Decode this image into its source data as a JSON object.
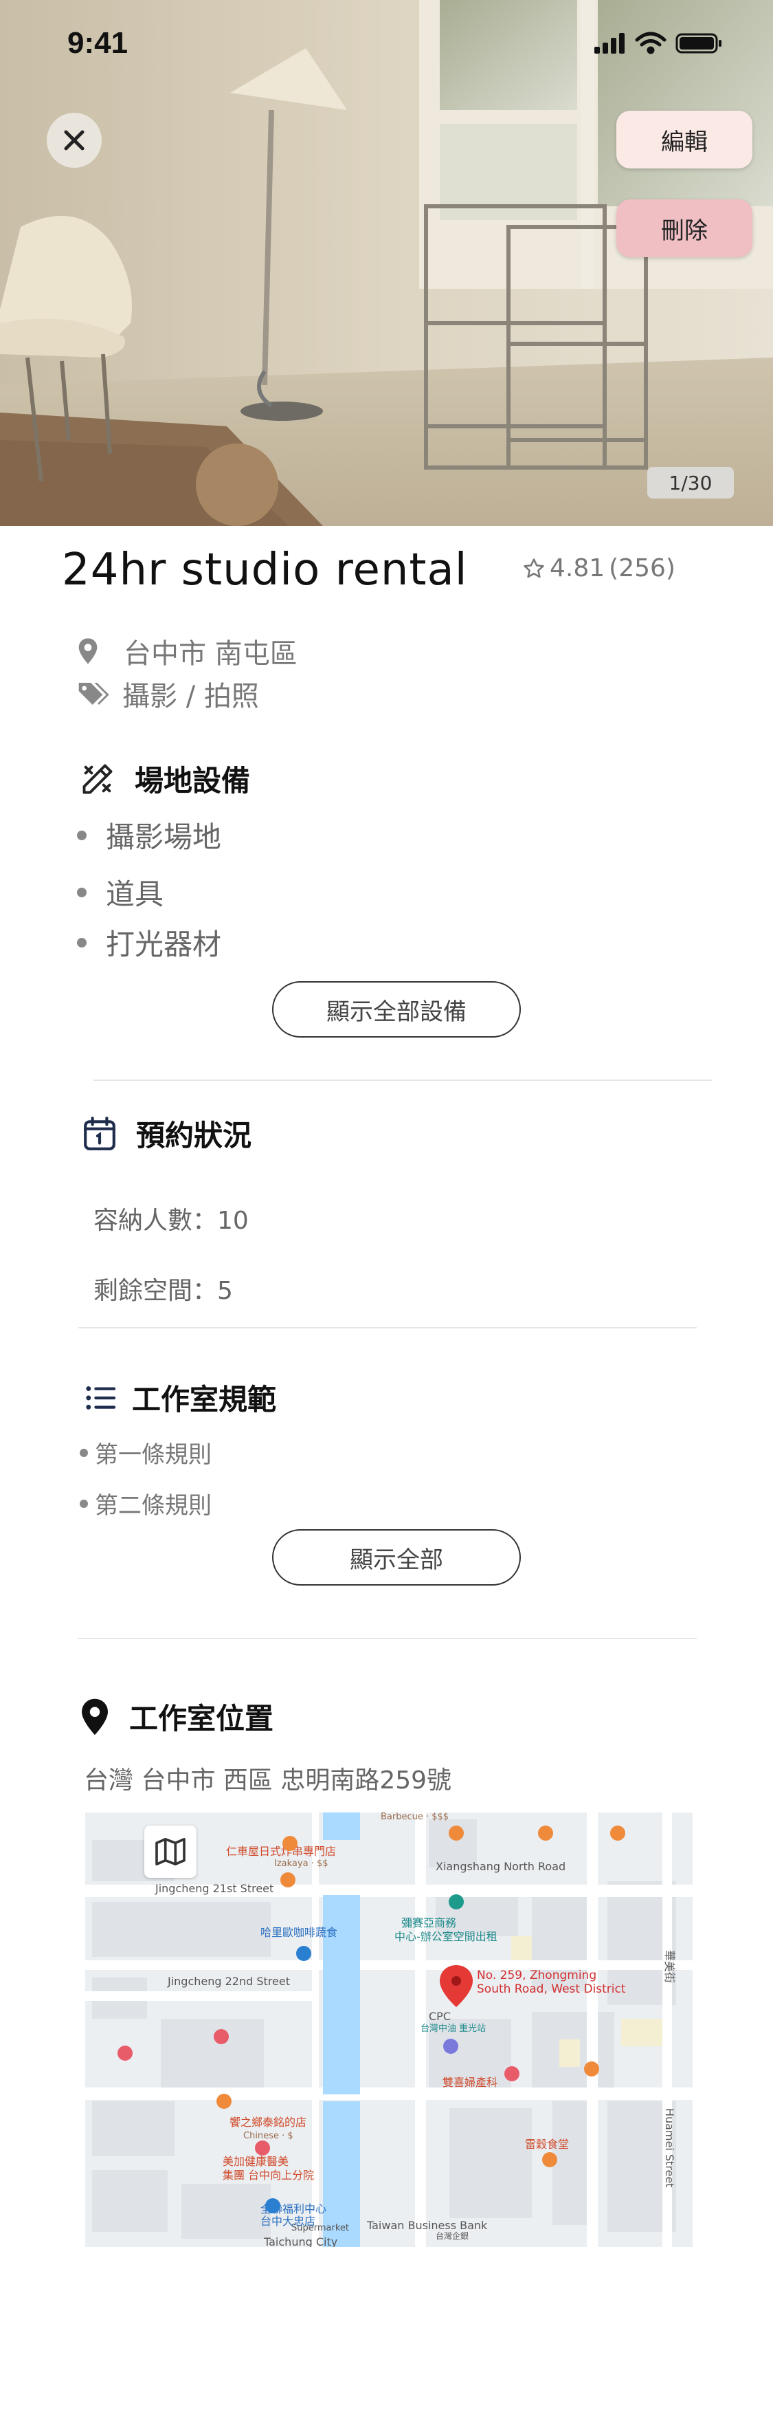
{
  "status_bar": {
    "time": "9:41"
  },
  "hero": {
    "counter": "1/30",
    "edit_label": "編輯",
    "delete_label": "刪除"
  },
  "listing": {
    "title": "24hr studio rental",
    "rating": "4.81",
    "reviews": "(256)",
    "location": "台中市 南屯區",
    "category": "攝影 / 拍照"
  },
  "equipment": {
    "heading": "場地設備",
    "items": [
      "攝影場地",
      "道具",
      "打光器材"
    ],
    "show_all_label": "顯示全部設備"
  },
  "booking": {
    "heading": "預約狀況",
    "capacity": "容納人數：10",
    "remaining": "剩餘空間：5"
  },
  "rules": {
    "heading": "工作室規範",
    "items": [
      "第一條規則",
      "第二條規則"
    ],
    "show_all_label": "顯示全部"
  },
  "location_section": {
    "heading": "工作室位置",
    "address": "台灣 台中市 西區 忠明南路259號"
  },
  "map": {
    "pin_label_1": "No. 259, Zhongming",
    "pin_label_2": "South Road, West District",
    "labels": {
      "l1": "仁車屋日式炸串專門店",
      "l1b": "Izakaya · $$",
      "l2": "Jingcheng 21st Street",
      "l3": "Xiangshang North Road",
      "l4": "彌賽亞商務",
      "l5": "中心-辦公室空間出租",
      "l6": "哈里歐咖啡蔬食",
      "l7": "Jingcheng 22nd Street",
      "l8": "CPC",
      "l9": "台灣中油 重光站",
      "l10": "雙喜婦產科",
      "l11": "饗之鄉泰銘的店",
      "l11b": "Chinese · $",
      "l12": "美加健康醫美",
      "l13": "集團 台中向上分院",
      "l14": "雷穀食堂",
      "l15": "全聯福利中心",
      "l16": "台中大忠店",
      "l16b": "Supermarket",
      "l17": "Taiwan Business Bank",
      "l17b": "台灣企銀",
      "l18": "Taichung City",
      "l19": "華美街",
      "l20": "Huamei Street",
      "l21": "Barbecue · $$$"
    }
  },
  "colors": {
    "edit_bg": "#fbe9e6",
    "delete_bg": "#efbfc4",
    "text_dark": "#111111",
    "text_muted": "#777777",
    "map_water": "#aadaff",
    "map_pin": "#e53935"
  }
}
